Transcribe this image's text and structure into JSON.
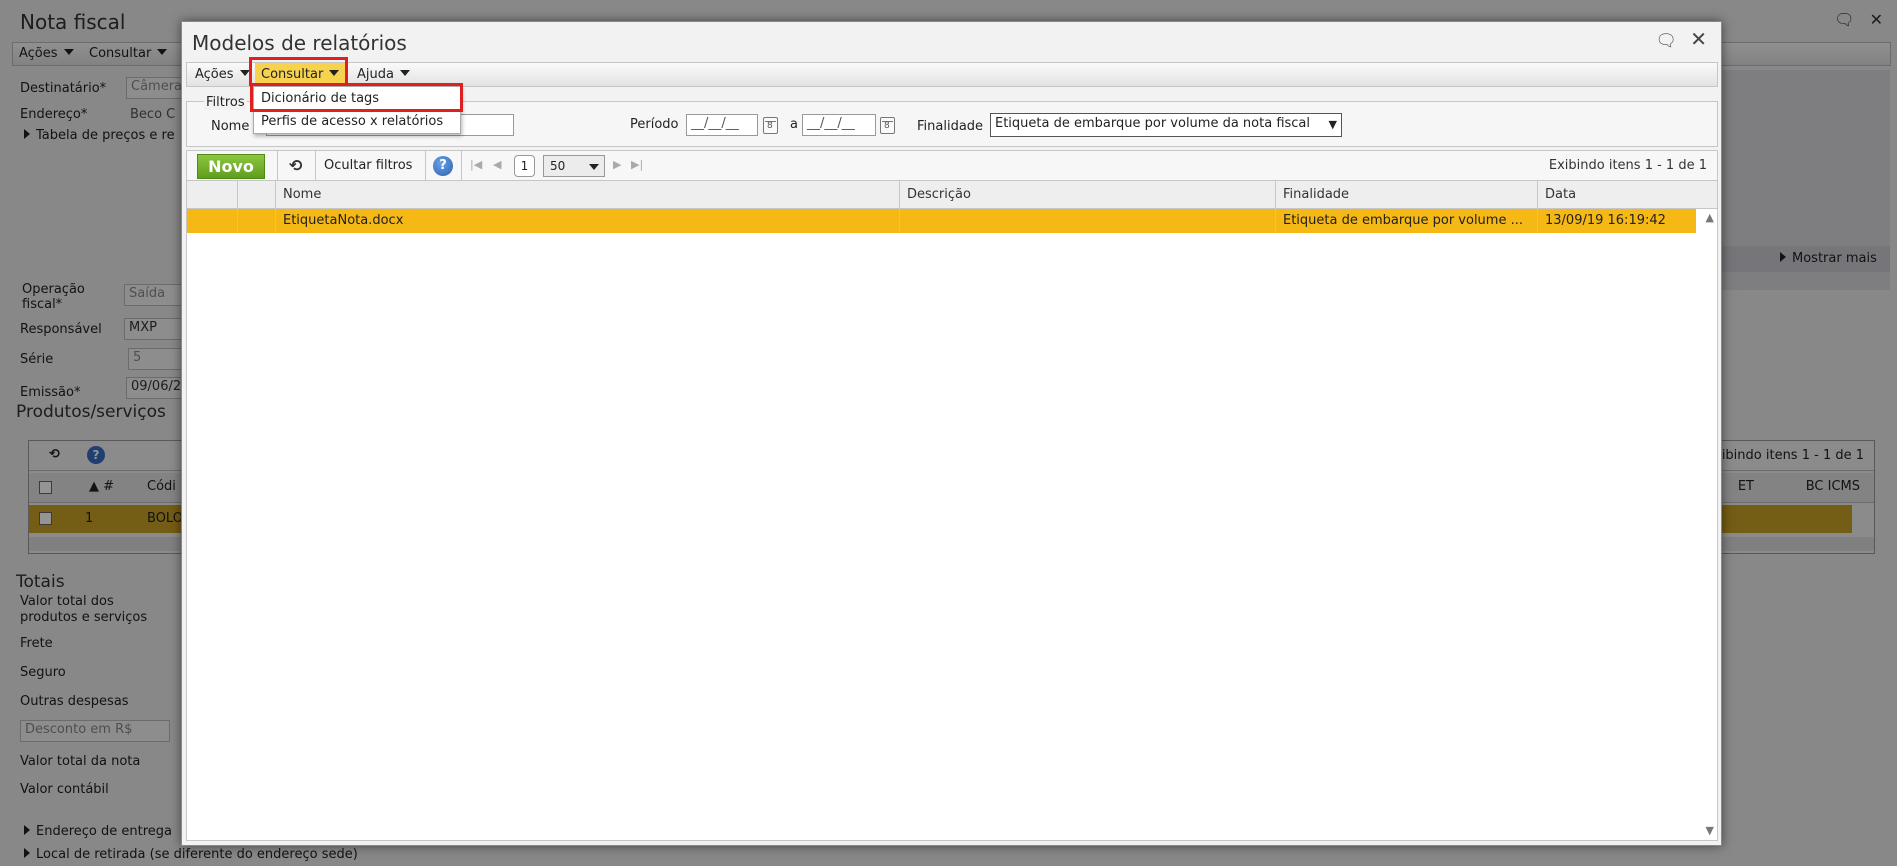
{
  "background": {
    "title": "Nota fiscal",
    "menu": [
      "Ações",
      "Consultar"
    ],
    "fields": {
      "destinatario_label": "Destinatário*",
      "destinatario_value": "Câmera",
      "endereco_label": "Endereço*",
      "endereco_value": "Beco C",
      "tabela_precos": "Tabela de preços e re",
      "operacao_label_1": "Operação",
      "operacao_label_2": "fiscal*",
      "operacao_value": "Saída",
      "responsavel_label": "Responsável",
      "responsavel_value": "MXP",
      "serie_label": "Série",
      "serie_value": "5",
      "emissao_label": "Emissão*",
      "emissao_value": "09/06/2"
    },
    "produtos_section": "Produtos/serviços",
    "mostrar_mais": "Mostrar mais",
    "grid": {
      "paging": "ibindo itens 1 - 1 de 1",
      "col_hash": "#",
      "col_codigo": "Códi",
      "col_et": "ET",
      "col_bc_icms": "BC ICMS",
      "row_num": "1",
      "row_code": "BOLO"
    },
    "totais_section": "Totais",
    "totais": [
      "Valor total dos",
      "produtos e serviços",
      "Frete",
      "Seguro",
      "Outras despesas",
      "Desconto em R$",
      "Valor total da nota",
      "Valor contábil"
    ],
    "bottom": [
      "Endereço de entrega",
      "Local de retirada (se diferente do endereço sede)"
    ]
  },
  "modal": {
    "title": "Modelos de relatórios",
    "menu": {
      "acoes": "Ações",
      "consultar": "Consultar",
      "ajuda": "Ajuda"
    },
    "consultar_dropdown": [
      "Dicionário de tags",
      "Perfis de acesso x relatórios"
    ],
    "filters": {
      "legend": "Filtros",
      "nome_label": "Nome",
      "nome_value": "",
      "periodo_label": "Período",
      "periodo_from": "__/__/__",
      "periodo_sep": "a",
      "periodo_to": "__/__/__",
      "finalidade_label": "Finalidade",
      "finalidade_value": "Etiqueta de embarque por volume da nota fiscal"
    },
    "toolbar": {
      "novo": "Novo",
      "ocultar_filtros": "Ocultar filtros",
      "help": "?",
      "page": "1",
      "page_size": "50",
      "paging_info": "Exibindo itens 1 - 1 de 1"
    },
    "columns": [
      "Nome",
      "Descrição",
      "Finalidade",
      "Data"
    ],
    "rows": [
      {
        "nome": "EtiquetaNota.docx",
        "descricao": "",
        "finalidade": "Etiqueta de embarque por volume ...",
        "data": "13/09/19 16:19:42"
      }
    ]
  },
  "colors": {
    "selected_row": "#f5b815",
    "highlight_border": "#e01f1f",
    "menu_active": "#f7d24e",
    "novo_button": "#6fae27"
  },
  "icons": {
    "chat": "chat-bubble-icon",
    "close": "close-icon",
    "refresh": "refresh-icon",
    "help": "help-icon",
    "calendar": "calendar-icon",
    "status": "lightbulb-icon"
  }
}
